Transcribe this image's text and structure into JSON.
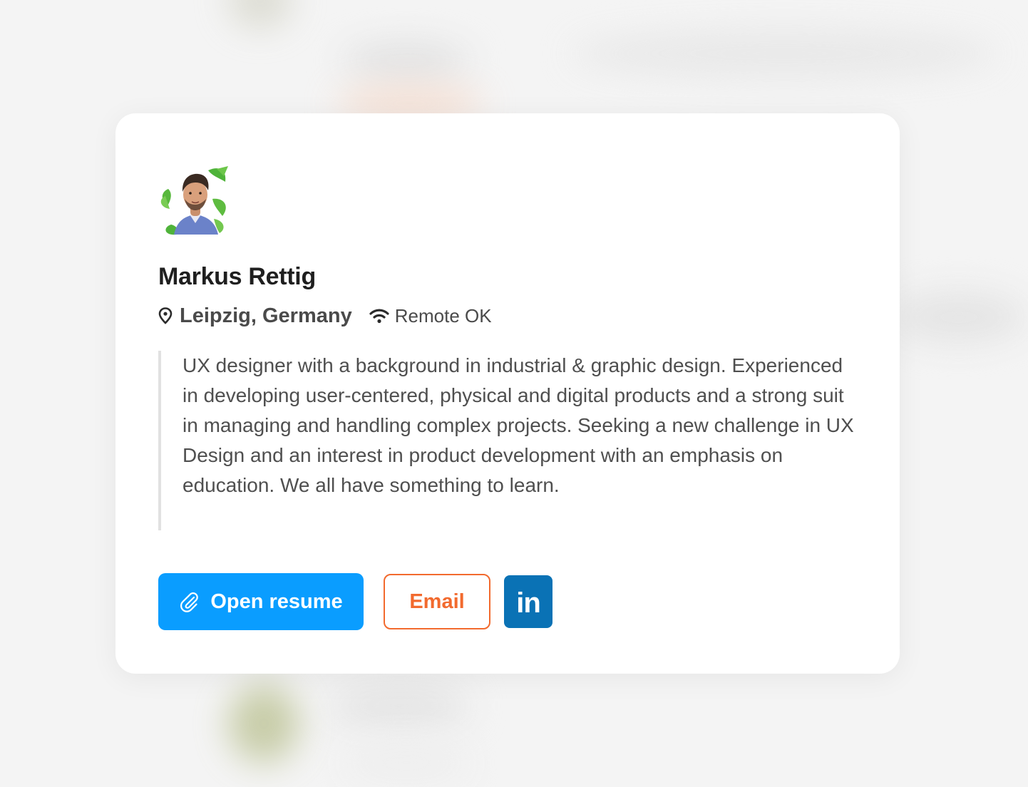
{
  "profile": {
    "name": "Markus Rettig",
    "location": "Leipzig, Germany",
    "remote": "Remote OK",
    "bio": "UX designer with a background in industrial & graphic design. Experienced in developing user-centered, physical and digital products and a strong suit in managing and handling complex projects. Seeking a new challenge in UX Design and an interest in product development with an emphasis on education. We all have something to learn."
  },
  "actions": {
    "resume_label": "Open resume",
    "email_label": "Email",
    "linkedin_label": "in"
  },
  "icons": {
    "location": "map-pin-icon",
    "remote": "wifi-icon",
    "resume": "paperclip-icon",
    "linkedin": "linkedin-icon"
  },
  "colors": {
    "primary": "#0a9dff",
    "email_accent": "#f26a2e",
    "linkedin": "#0a72b5",
    "text": "#1f1f1f"
  }
}
